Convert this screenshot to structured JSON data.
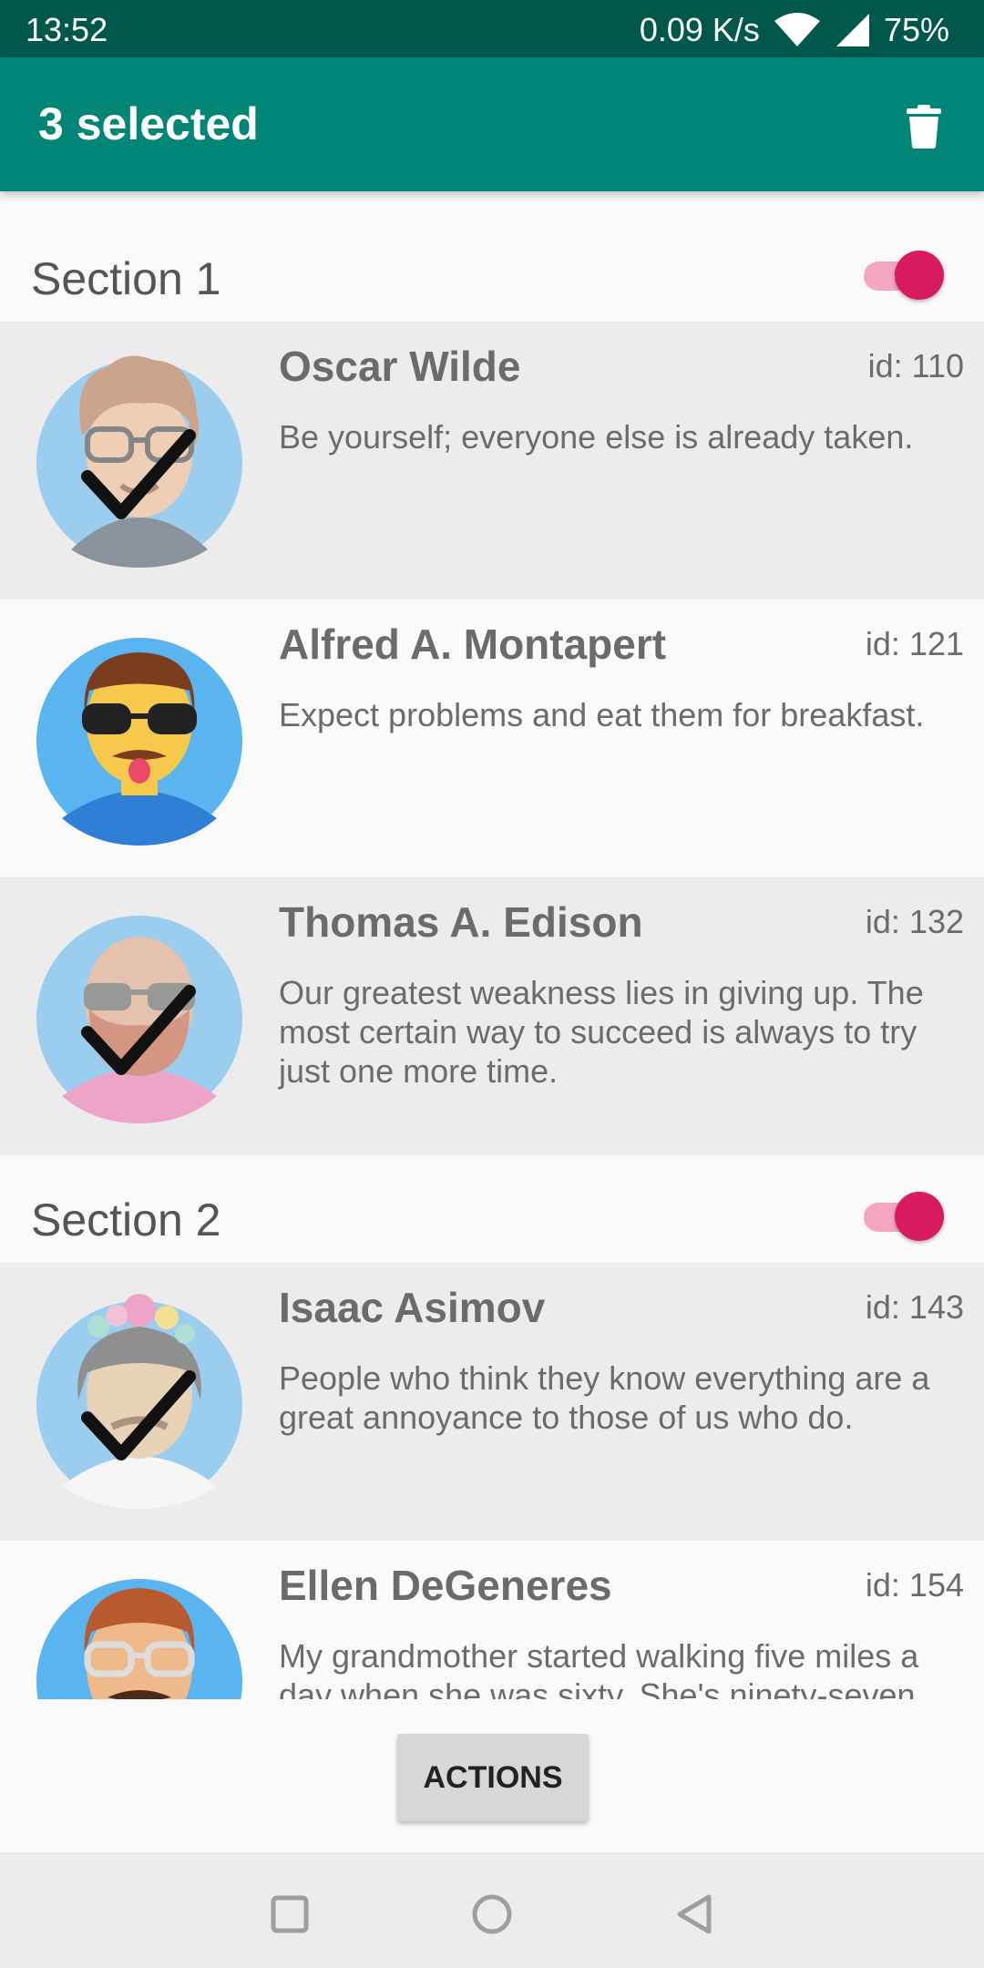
{
  "status_bar": {
    "time": "13:52",
    "network_speed": "0.09 K/s",
    "battery": "75%",
    "icons": [
      "wifi-icon",
      "signal-icon"
    ]
  },
  "app_bar": {
    "title": "3 selected",
    "delete_icon": "trash-icon",
    "color": "#008577"
  },
  "sections": [
    {
      "label": "Section 1",
      "toggle_on": true,
      "items": [
        {
          "name": "Oscar Wilde",
          "id": "id: 110",
          "quote": "Be yourself; everyone else is already taken.",
          "selected": true,
          "avatar": "avatar-curly-hair-glasses"
        },
        {
          "name": "Alfred A. Montapert",
          "id": "id: 121",
          "quote": "Expect problems and eat them for breakfast.",
          "selected": false,
          "avatar": "avatar-sunglasses-tongue"
        },
        {
          "name": "Thomas A. Edison",
          "id": "id: 132",
          "quote": "Our greatest weakness lies in giving up. The most certain way to succeed is always to try just one more time.",
          "selected": true,
          "avatar": "avatar-bald-beard"
        }
      ]
    },
    {
      "label": "Section 2",
      "toggle_on": true,
      "items": [
        {
          "name": "Isaac Asimov",
          "id": "id: 143",
          "quote": "People who think they know everything are a great annoyance to those of us who do.",
          "selected": true,
          "avatar": "avatar-flower-crown"
        },
        {
          "name": "Ellen DeGeneres",
          "id": "id: 154",
          "quote": "My grandmother started walking five miles a day when she was sixty. She's ninety-seven",
          "selected": false,
          "avatar": "avatar-glasses-mustache"
        }
      ]
    }
  ],
  "actions_button": "ACTIONS",
  "nav_bar": [
    "recents-icon",
    "home-icon",
    "back-icon"
  ],
  "colors": {
    "accent": "#d81b60",
    "primary_dark": "#00574b"
  }
}
